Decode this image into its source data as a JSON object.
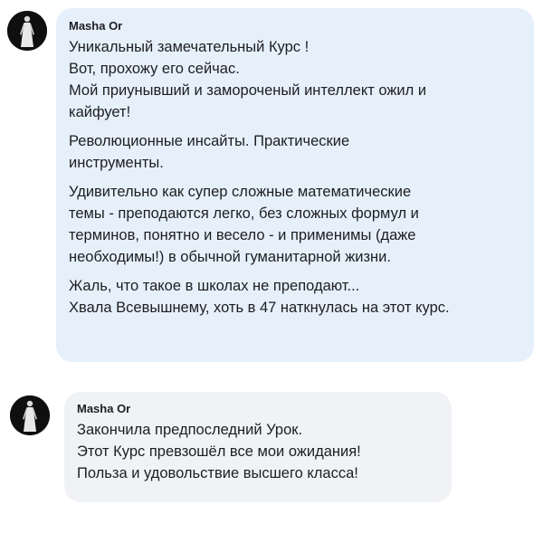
{
  "comments": [
    {
      "author": "Masha Or",
      "avatar_icon": "user-avatar-icon",
      "paragraphs": [
        [
          "Уникальный замечательный Курс !",
          "Вот, прохожу его сейчас.",
          "Мой приунывший и замороченый интеллект ожил и",
          "кайфует!"
        ],
        [
          "Революционные инсайты. Практические",
          "инструменты."
        ],
        [
          "Удивительно как супер сложные математические",
          "темы - преподаются легко, без сложных формул и",
          "терминов, понятно и весело - и применимы (даже",
          "необходимы!) в обычной гуманитарной жизни."
        ],
        [
          "Жаль, что такое в школах не преподают...",
          "Хвала Всевышнему, хоть в 47 наткнулась на этот курс."
        ]
      ],
      "bubble_color": "#e6f0fb"
    },
    {
      "author": "Masha Or",
      "avatar_icon": "user-avatar-icon",
      "paragraphs": [
        [
          "Закончила предпоследний Урок.",
          "Этот Курс превзошёл все мои ожидания!",
          "Польза и удовольствие высшего класса!"
        ]
      ],
      "bubble_color": "#f0f2f5"
    }
  ]
}
